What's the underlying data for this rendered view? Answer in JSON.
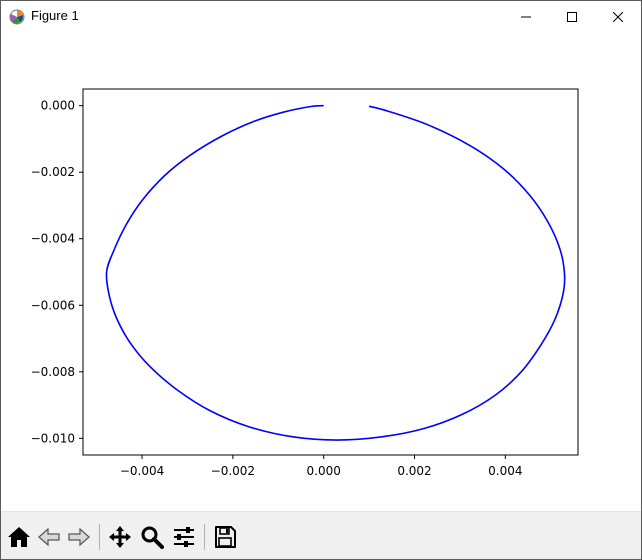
{
  "window": {
    "title": "Figure 1",
    "app_icon": "matplotlib-logo-icon",
    "controls": [
      "minimize-icon",
      "maximize-icon",
      "close-icon"
    ]
  },
  "toolbar": {
    "buttons": [
      {
        "name": "home-button",
        "icon": "home-icon",
        "tooltip": "Reset original view"
      },
      {
        "name": "back-button",
        "icon": "arrow-left-icon",
        "tooltip": "Back to previous view"
      },
      {
        "name": "forward-button",
        "icon": "arrow-right-icon",
        "tooltip": "Forward to next view"
      },
      {
        "name": "pan-button",
        "icon": "move-icon",
        "tooltip": "Pan axes"
      },
      {
        "name": "zoom-button",
        "icon": "magnifier-icon",
        "tooltip": "Zoom to rectangle"
      },
      {
        "name": "configure-button",
        "icon": "sliders-icon",
        "tooltip": "Configure subplots"
      },
      {
        "name": "save-button",
        "icon": "floppy-disk-icon",
        "tooltip": "Save the figure"
      }
    ],
    "coordinates": ""
  },
  "chart_data": {
    "type": "line",
    "title": "",
    "xlabel": "",
    "ylabel": "",
    "xlim": [
      -0.0053,
      0.0056
    ],
    "ylim": [
      -0.0105,
      0.0005
    ],
    "xticks": [
      -0.004,
      -0.002,
      0.0,
      0.002,
      0.004
    ],
    "xtick_labels": [
      "−0.004",
      "−0.002",
      "0.000",
      "0.002",
      "0.004"
    ],
    "yticks": [
      0.0,
      -0.002,
      -0.004,
      -0.006,
      -0.008,
      -0.01
    ],
    "ytick_labels": [
      "0.000",
      "−0.002",
      "−0.004",
      "−0.006",
      "−0.008",
      "−0.010"
    ],
    "grid": false,
    "series": [
      {
        "color": "#0000ff",
        "x": [
          0.0,
          -0.0003,
          -0.0009,
          -0.00155,
          -0.00225,
          -0.00295,
          -0.0035,
          -0.004,
          -0.00435,
          -0.00462,
          -0.00478,
          -0.00472,
          -0.00455,
          -0.00425,
          -0.00382,
          -0.00322,
          -0.0025,
          -0.00165,
          -0.0007,
          0.0003,
          0.0013,
          0.00222,
          0.00305,
          0.00378,
          0.00435,
          0.00478,
          0.0051,
          0.00528,
          0.0053,
          0.0052,
          0.00494,
          0.00454,
          0.00396,
          0.00322,
          0.0023,
          0.0014,
          0.001
        ],
        "y": [
          0.0,
          -3e-05,
          -0.0002,
          -0.00048,
          -0.00092,
          -0.0015,
          -0.0021,
          -0.00285,
          -0.00358,
          -0.00435,
          -0.005,
          -0.00572,
          -0.00642,
          -0.00715,
          -0.00785,
          -0.00855,
          -0.00917,
          -0.00965,
          -0.00995,
          -0.01005,
          -0.00995,
          -0.0097,
          -0.00928,
          -0.0087,
          -0.008,
          -0.0072,
          -0.0064,
          -0.0056,
          -0.005,
          -0.0043,
          -0.0035,
          -0.0027,
          -0.0019,
          -0.0012,
          -0.00058,
          -0.00016,
          -2e-05
        ]
      }
    ]
  }
}
